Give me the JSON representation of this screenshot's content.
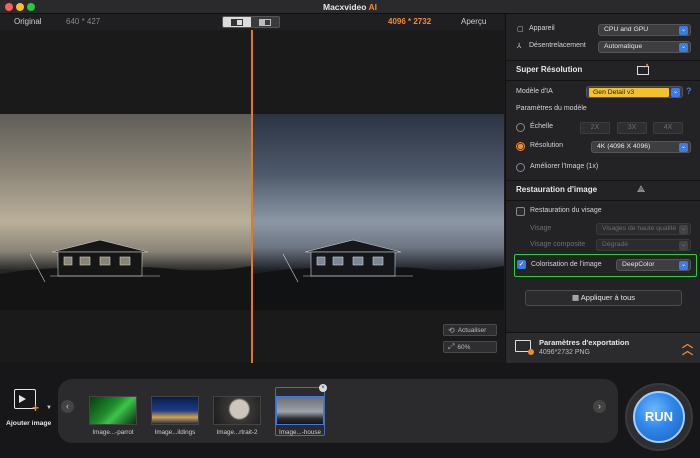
{
  "app": {
    "title_main": "Macxvideo",
    "title_ai": "AI"
  },
  "preview": {
    "original_label": "Original",
    "original_size": "640 * 427",
    "output_size": "4096 * 2732",
    "preview_label": "Aperçu",
    "refresh_label": "Actualiser",
    "zoom_level": "60%",
    "divider_color": "#e07a2a"
  },
  "settings": {
    "device_label": "Appareil",
    "device_value": "CPU and GPU",
    "deinterlace_label": "Désentrelacement",
    "deinterlace_value": "Automatique",
    "super_resolution": {
      "title": "Super Résolution",
      "model_label": "Modèle d'IA",
      "model_value": "Gen Detail v3",
      "help_glyph": "?",
      "params_label": "Paramètres du modèle",
      "scale_label": "Échelle",
      "scale_options": [
        "2X",
        "3X",
        "4X"
      ],
      "resolution_label": "Résolution",
      "resolution_value": "4K (4096 X 4096)",
      "improve_label": "Améliorer l'Image (1x)"
    },
    "restoration": {
      "title": "Restauration d'image",
      "face_label": "Restauration du visage",
      "face_checked": false,
      "visage_label": "Visage",
      "visage_value": "Visages de haute qualité",
      "composite_label": "Visage composite",
      "composite_value": "Dégradé",
      "colorization_label": "Colorisation de l'image",
      "colorization_checked": true,
      "colorization_value": "DeepColor"
    },
    "apply_all_label": "Appliquer à tous",
    "export": {
      "title": "Paramètres d'exportation",
      "subtitle": "4096*2732 PNG"
    }
  },
  "bottom": {
    "add_label": "Ajouter image",
    "thumbnails": [
      {
        "label": "Image...-parrot"
      },
      {
        "label": "Image...ildings"
      },
      {
        "label": "Image...rtrait-2"
      },
      {
        "label": "Image...-house",
        "selected": true
      }
    ],
    "run_label": "RUN"
  },
  "colors": {
    "accent_orange": "#f28b30",
    "accent_blue": "#3d7ce8",
    "highlight_green": "#2ecc40"
  }
}
